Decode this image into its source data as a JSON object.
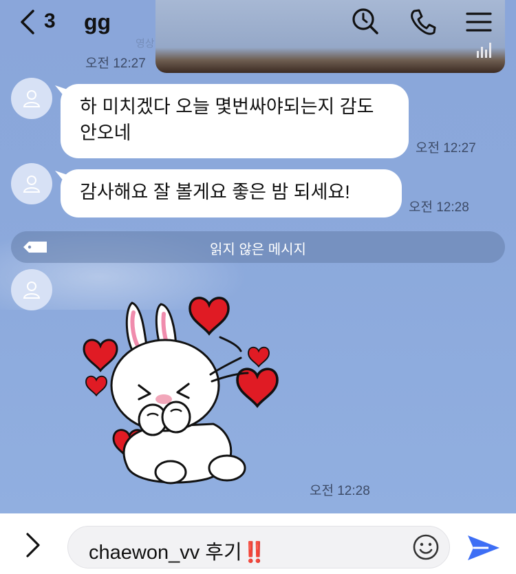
{
  "header": {
    "back_count": "3",
    "room_title": "gg",
    "ghost_text": "영상",
    "search_icon": "search-clock-icon",
    "call_icon": "phone-icon",
    "menu_icon": "hamburger-menu-icon"
  },
  "messages": [
    {
      "time": "오전 12:27",
      "text": ""
    },
    {
      "time": "오전 12:27",
      "text": "하 미치겠다 오늘 몇번싸야되는지 감도 안오네"
    },
    {
      "time": "오전 12:28",
      "text": "감사해요 잘 볼게요 좋은 밤 되세요!"
    },
    {
      "time": "오전 12:28",
      "sticker": "bunny-hearts-sticker"
    }
  ],
  "unread_divider": "읽지 않은 메시지",
  "composer": {
    "text": "chaewon_vv 후기‼️",
    "emoji_icon": "smiley-icon",
    "send_icon": "send-icon",
    "expand_icon": "chevron-right-icon"
  },
  "colors": {
    "chat_background": "#8ba7d9",
    "bubble": "#ffffff",
    "send": "#3d6ef5"
  }
}
